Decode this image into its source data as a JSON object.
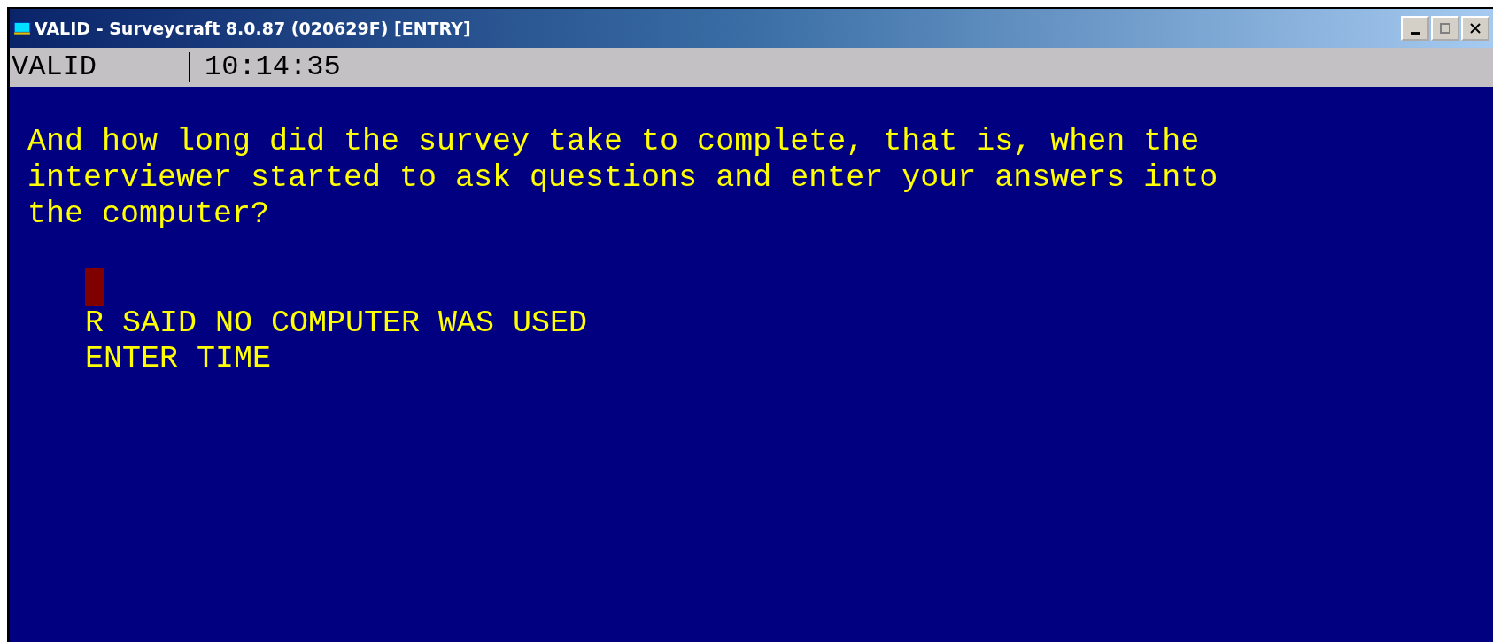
{
  "window": {
    "title": "VALID - Surveycraft 8.0.87 (020629F) [ENTRY]"
  },
  "status_bar": {
    "mode": "VALID",
    "time": "10:14:35"
  },
  "question": [
    "And how long did the survey take to complete, that is, when the",
    "interviewer started to ask questions and enter your answers into",
    "the computer?"
  ],
  "answer": {
    "cursor": true,
    "options": [
      "R SAID NO COMPUTER WAS USED",
      "ENTER TIME"
    ]
  }
}
